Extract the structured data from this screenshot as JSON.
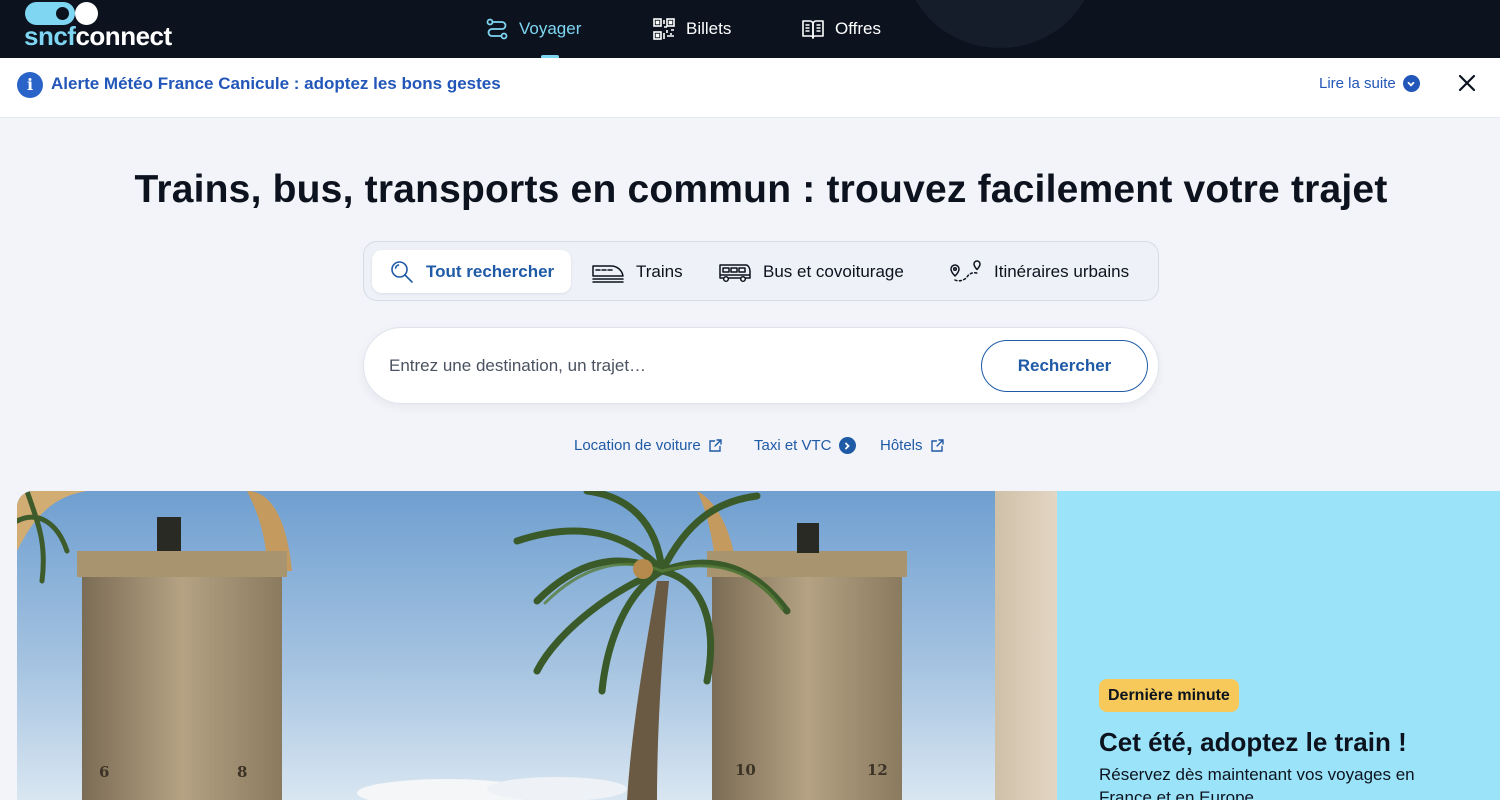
{
  "brand": {
    "logo_text_a": "sncf",
    "logo_text_b": "connect"
  },
  "nav": {
    "items": [
      {
        "label": "Voyager",
        "icon": "route-icon",
        "active": true
      },
      {
        "label": "Billets",
        "icon": "qr-code-icon",
        "active": false
      },
      {
        "label": "Offres",
        "icon": "open-book-icon",
        "active": false
      }
    ]
  },
  "alert": {
    "icon": "info-icon",
    "text": "Alerte Météo France Canicule : adoptez les bons gestes",
    "more_label": "Lire la suite"
  },
  "hero": {
    "title": "Trains, bus, transports en commun : trouvez facilement votre trajet"
  },
  "search_tabs": [
    {
      "label": "Tout rechercher",
      "icon": "search-icon",
      "active": true
    },
    {
      "label": "Trains",
      "icon": "train-icon",
      "active": false
    },
    {
      "label": "Bus et covoiturage",
      "icon": "bus-icon",
      "active": false
    },
    {
      "label": "Itinéraires urbains",
      "icon": "map-route-icon",
      "active": false
    }
  ],
  "search": {
    "placeholder": "Entrez une destination, un trajet…",
    "value": "",
    "button_label": "Rechercher"
  },
  "quick_links": [
    {
      "label": "Location de voiture",
      "icon": "external-link-icon"
    },
    {
      "label": "Taxi et VTC",
      "icon": "chevron-right-circle-icon"
    },
    {
      "label": "Hôtels",
      "icon": "external-link-icon"
    }
  ],
  "promo": {
    "badge": "Dernière minute",
    "title": "Cet été, adoptez le train !",
    "text": "Réservez dès maintenant vos voyages en France et en Europe"
  },
  "colors": {
    "nav_bg": "#0c131f",
    "accent_light": "#7fd6f2",
    "link_blue": "#1f5aa6",
    "alert_blue": "#2256b8",
    "promo_bg": "#9be3f8",
    "badge_bg": "#f6c95a"
  }
}
